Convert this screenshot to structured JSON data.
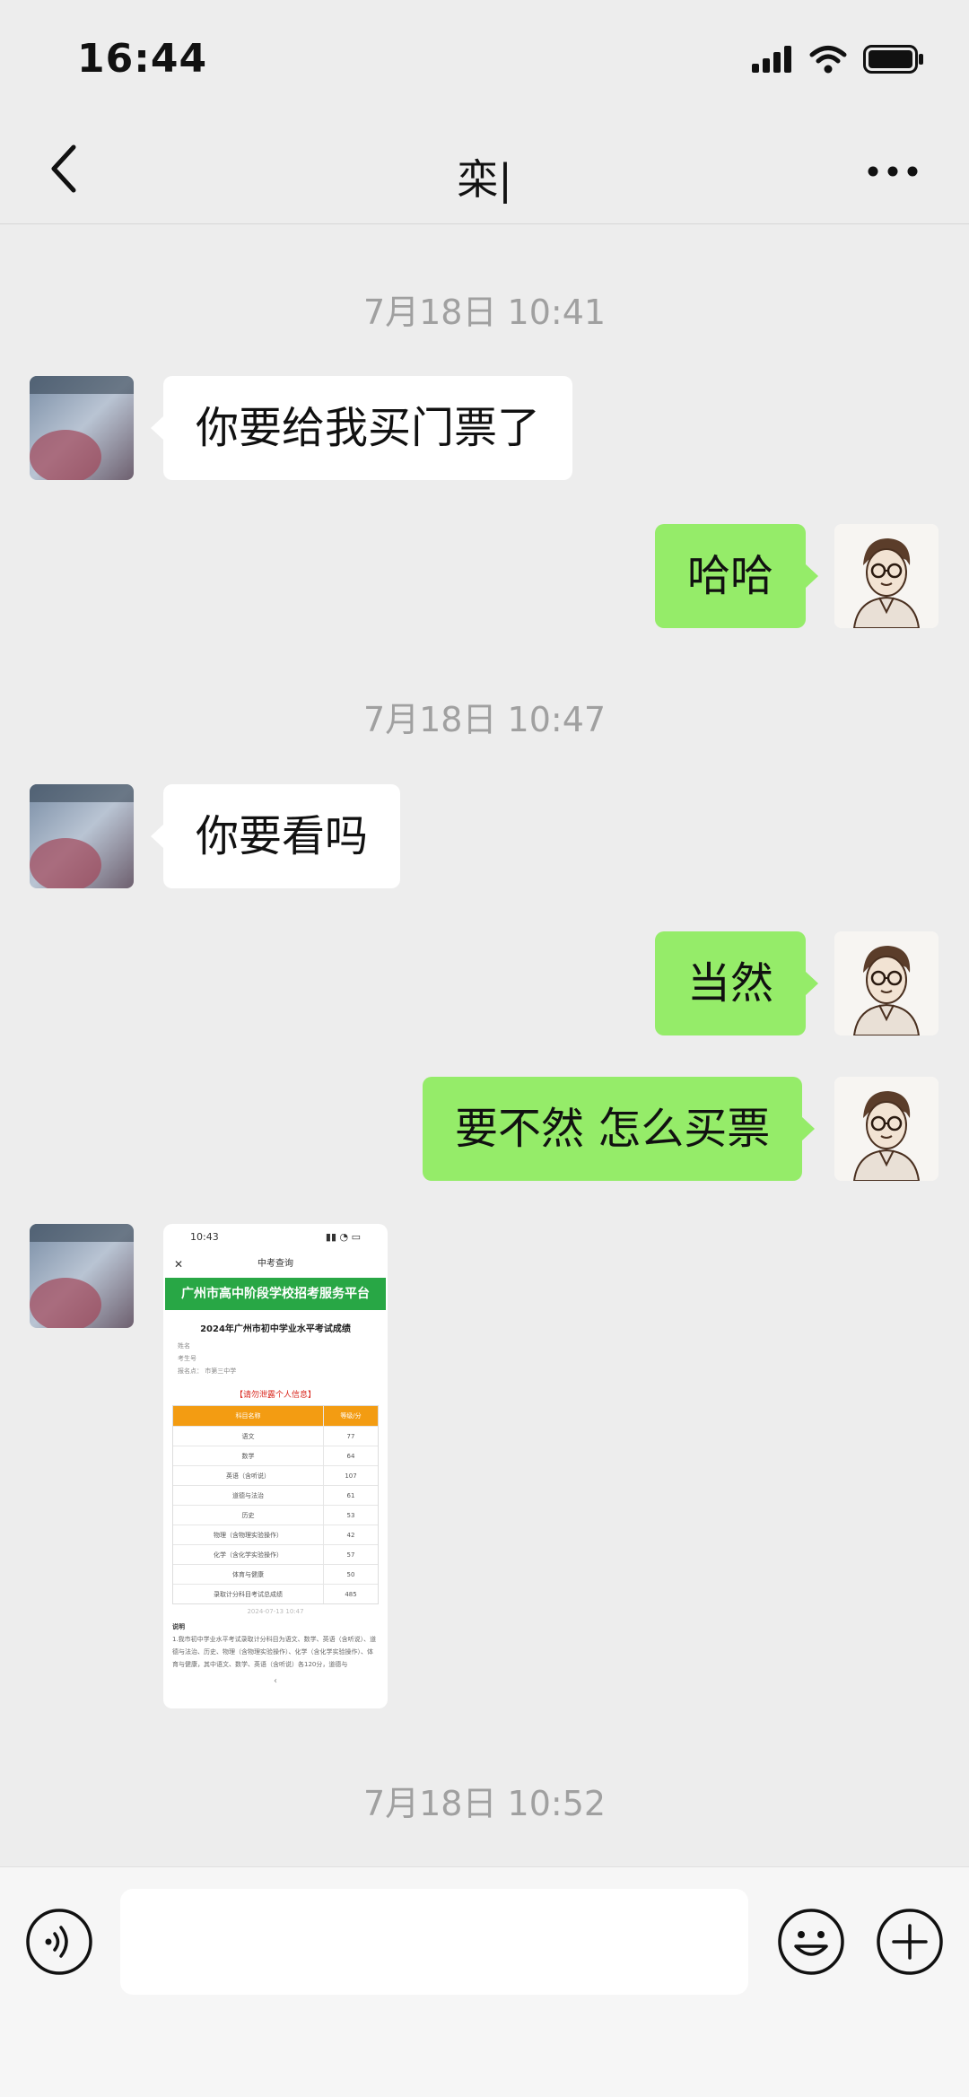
{
  "status_bar": {
    "time": "16:44"
  },
  "nav": {
    "title": "栾|"
  },
  "timestamps": [
    "7月18日 10:41",
    "7月18日 10:47",
    "7月18日 10:52"
  ],
  "messages": [
    {
      "side": "left",
      "text": "你要给我买门票了"
    },
    {
      "side": "right",
      "text": "哈哈"
    },
    {
      "side": "left",
      "text": "你要看吗"
    },
    {
      "side": "right",
      "text": "当然"
    },
    {
      "side": "right",
      "text": "要不然 怎么买票"
    }
  ],
  "image_message": {
    "time": "10:43",
    "nav_title": "中考查询",
    "banner": "广州市高中阶段学校招考服务平台",
    "subtitle": "2024年广州市初中学业水平考试成绩",
    "info_lines": [
      "姓名",
      "考生号",
      "报名点：      市第三中学"
    ],
    "red_note": "【请勿泄露个人信息】",
    "table_headers": [
      "科目名称",
      "等级/分"
    ],
    "table_rows": [
      [
        "语文",
        "77"
      ],
      [
        "数学",
        "64"
      ],
      [
        "英语（含听说）",
        "107"
      ],
      [
        "道德与法治",
        "61"
      ],
      [
        "历史",
        "53"
      ],
      [
        "物理（含物理实验操作）",
        "42"
      ],
      [
        "化学（含化学实验操作）",
        "57"
      ],
      [
        "体育与健康",
        "50"
      ],
      [
        "录取计分科目考试总成绩",
        "485"
      ]
    ],
    "date": "2024-07-13 10:47",
    "notes_head": "说明",
    "notes_text": "1.我市初中学业水平考试录取计分科目为语文、数学、英语（含听说）、道德与法治、历史、物理（含物理实验操作）、化学（含化学实验操作）、体育与健康，其中语文、数学、英语（含听说）各120分，道德与",
    "pager": "‹"
  },
  "input": {
    "placeholder": ""
  },
  "colors": {
    "background": "#ededed",
    "bubble_right": "#95ec69",
    "bubble_left": "#ffffff",
    "timestamp": "#a0a0a0"
  }
}
